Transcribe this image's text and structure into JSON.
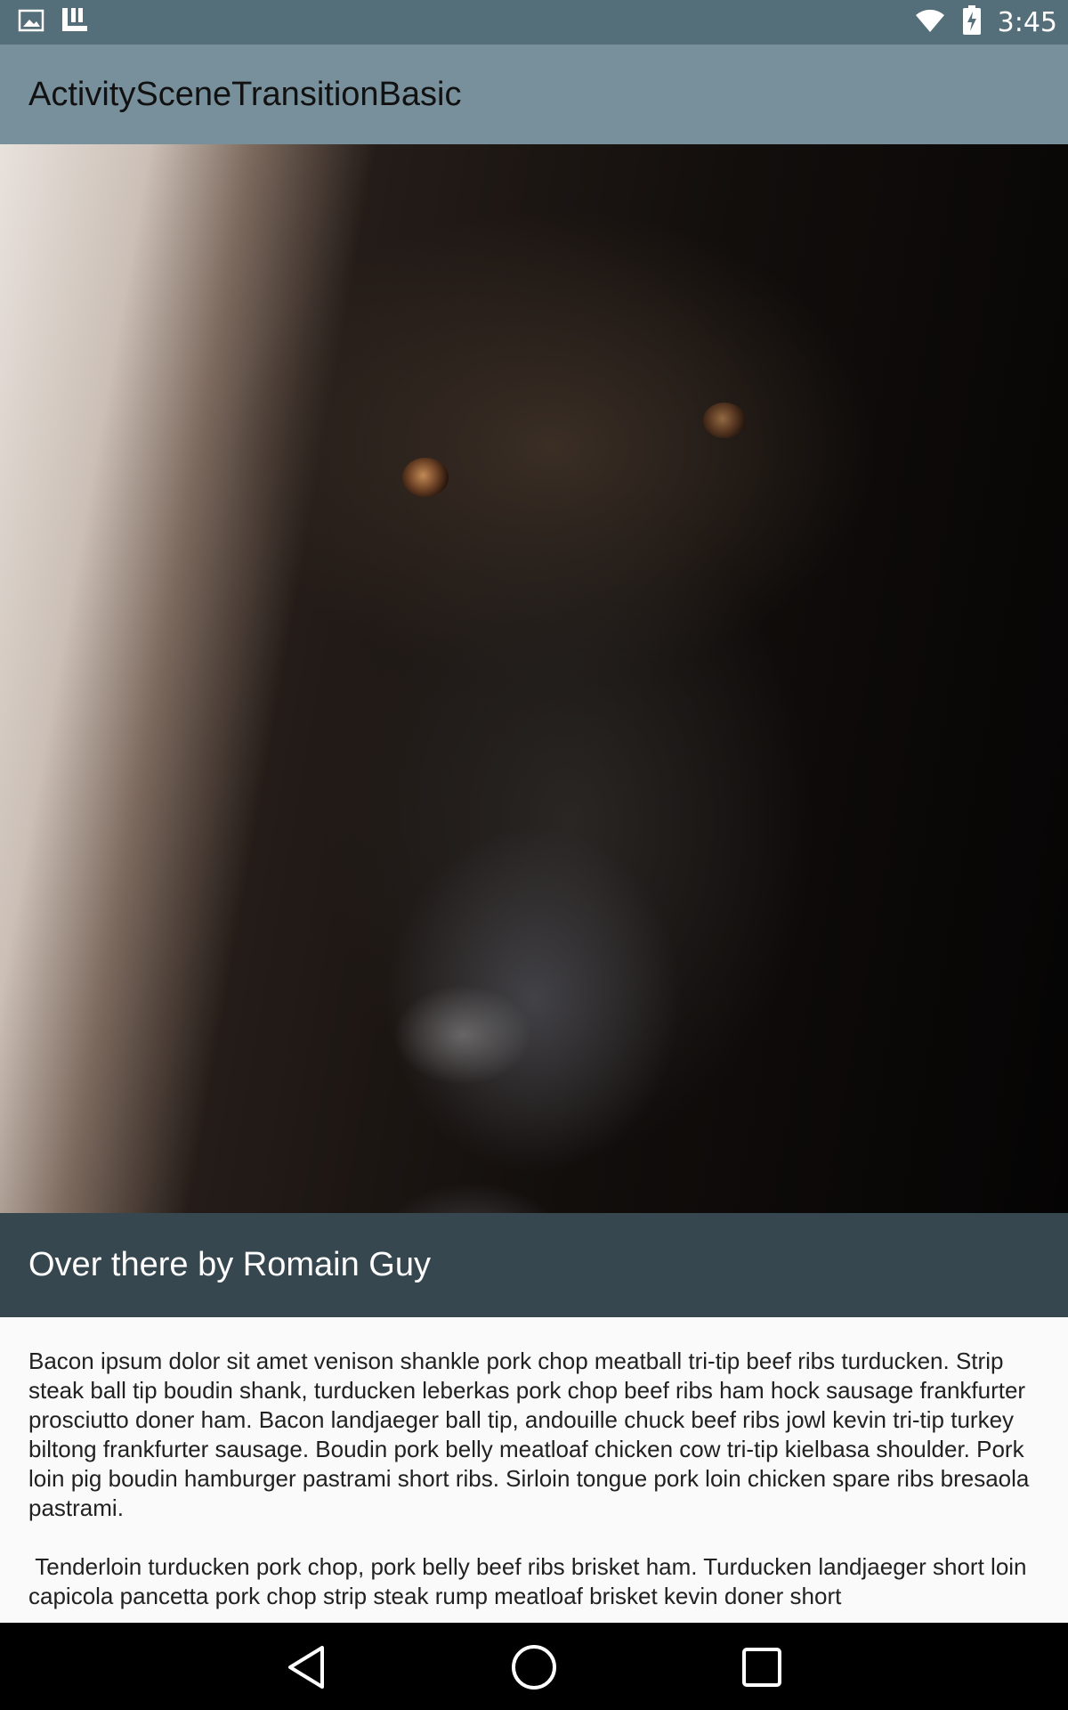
{
  "status_bar": {
    "time": "3:45",
    "left_icons": [
      "image-icon",
      "launcher-icon"
    ],
    "right_icons": [
      "wifi-icon",
      "battery-charging-icon"
    ]
  },
  "app_bar": {
    "title": "ActivitySceneTransitionBasic"
  },
  "hero_image": {
    "subject": "gorilla-portrait"
  },
  "caption": {
    "text": "Over there by Romain Guy"
  },
  "body": {
    "paragraphs": [
      "Bacon ipsum dolor sit amet venison shankle pork chop meatball tri-tip beef ribs turducken. Strip steak ball tip boudin shank, turducken leberkas pork chop beef ribs ham hock sausage frankfurter prosciutto doner ham. Bacon landjaeger ball tip, andouille chuck beef ribs jowl kevin tri-tip turkey biltong frankfurter sausage. Boudin pork belly meatloaf chicken cow tri-tip kielbasa shoulder. Pork loin pig boudin hamburger pastrami short ribs. Sirloin tongue pork loin chicken spare ribs bresaola pastrami.",
      " Tenderloin turducken pork chop, pork belly beef ribs brisket ham. Turducken landjaeger short loin capicola pancetta pork chop strip steak rump meatloaf brisket kevin doner short"
    ]
  },
  "nav_bar": {
    "buttons": [
      "back-icon",
      "home-icon",
      "recents-icon"
    ]
  },
  "colors": {
    "status_bar": "#546e7a",
    "app_bar": "#78909c",
    "caption_bar": "#37474f",
    "nav_bar": "#000000",
    "background": "#fafafa"
  }
}
